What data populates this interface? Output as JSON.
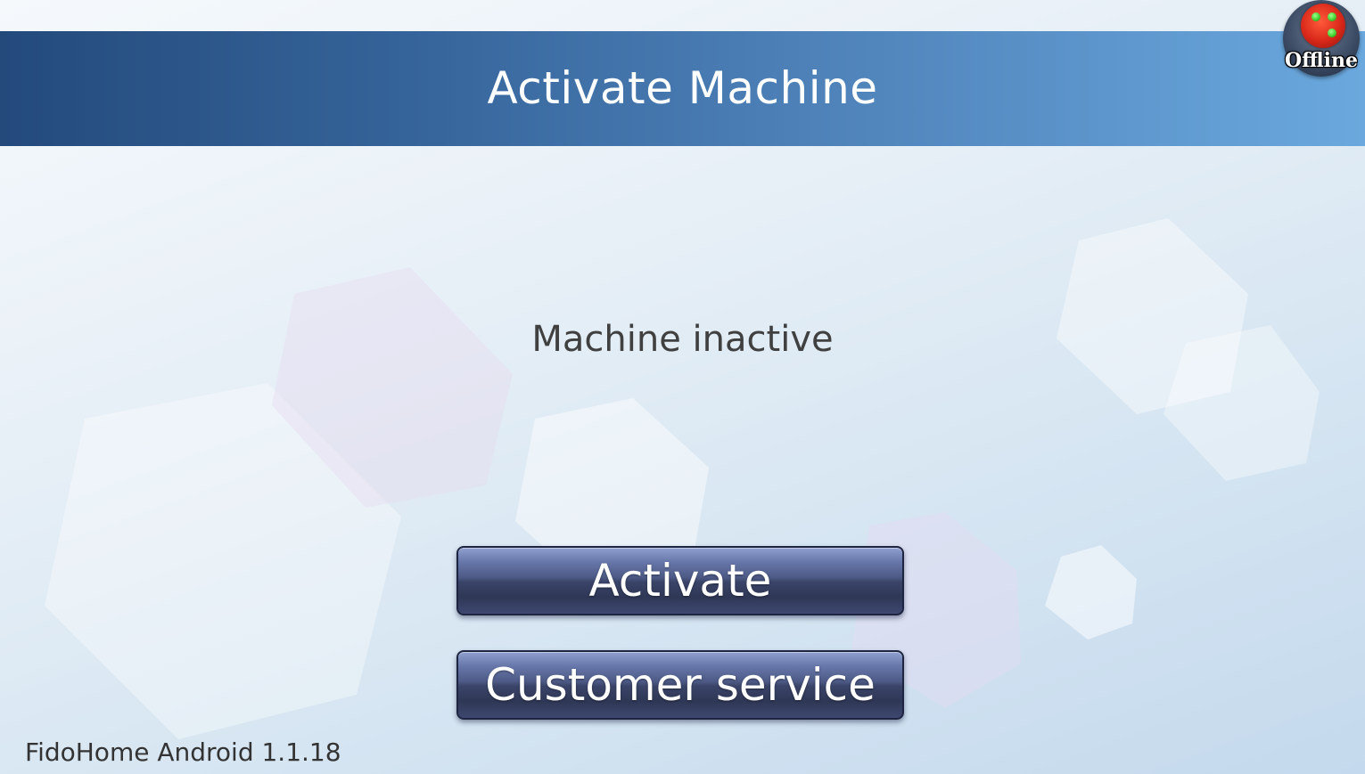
{
  "header": {
    "title": "Activate Machine"
  },
  "status_badge": {
    "label": "Offline",
    "icon": "traffic-light-icon",
    "light_color": "#d8281a",
    "dot_color": "#3ccd2c"
  },
  "main": {
    "status_message": "Machine inactive",
    "activate_label": "Activate",
    "customer_service_label": "Customer service"
  },
  "footer": {
    "version": "FidoHome Android 1.1.18"
  },
  "colors": {
    "header_start": "#244a7c",
    "header_end": "#6aa8dd",
    "button": "#4d5a86"
  }
}
